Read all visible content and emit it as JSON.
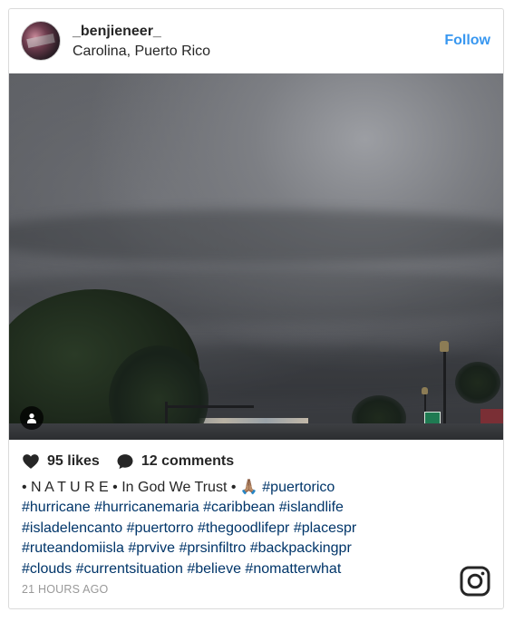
{
  "post": {
    "username": "_benjieneer_",
    "location": "Carolina, Puerto Rico",
    "follow_label": "Follow",
    "likes": "95 likes",
    "comments": "12 comments",
    "caption_prefix": "• N A T U R E • In God We Trust • 🙏🏽 ",
    "hashtags_line1": [
      "#puertorico"
    ],
    "hashtags_line2": [
      "#hurricane",
      "#hurricanemaria",
      "#caribbean",
      "#islandlife"
    ],
    "hashtags_line3": [
      "#isladelencanto",
      "#puertorro",
      "#thegoodlifepr",
      "#placespr"
    ],
    "hashtags_line4": [
      "#ruteandomiisla",
      "#prvive",
      "#prsinfiltro",
      "#backpackingpr"
    ],
    "hashtags_line5": [
      "#clouds",
      "#currentsituation",
      "#believe",
      "#nomatterwhat"
    ],
    "timestamp": "21 HOURS AGO"
  },
  "icons": {
    "like": "heart-icon",
    "comment": "comment-bubble-icon",
    "user_tag": "person-icon",
    "brand": "instagram-logo-icon"
  },
  "colors": {
    "link": "#003569",
    "follow": "#3897f0",
    "text": "#262626",
    "muted": "#999999",
    "border": "#dbdbdb"
  }
}
